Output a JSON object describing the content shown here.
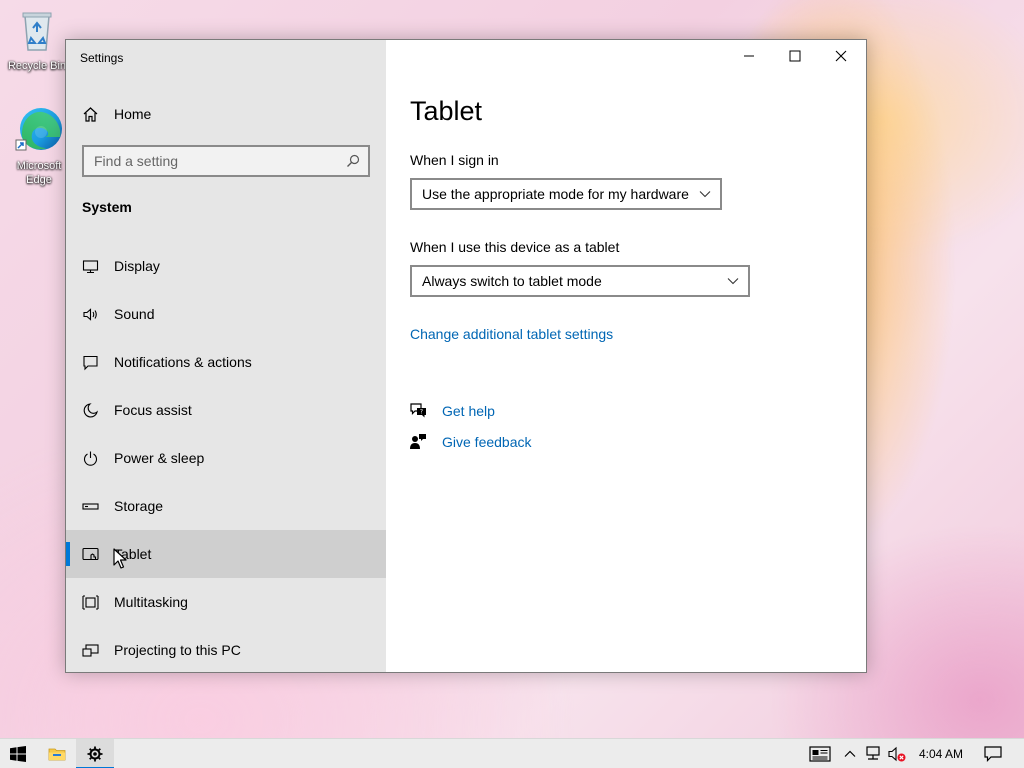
{
  "desktop": {
    "icons": [
      {
        "label": "Recycle Bin",
        "icon": "recycle-bin-icon"
      },
      {
        "label": "Microsoft Edge",
        "icon": "edge-icon"
      }
    ]
  },
  "window": {
    "title": "Settings",
    "controls": [
      "minimize",
      "maximize",
      "close"
    ]
  },
  "sidebar": {
    "home_label": "Home",
    "search_placeholder": "Find a setting",
    "section_title": "System",
    "items": [
      {
        "label": "Display",
        "icon": "display-icon"
      },
      {
        "label": "Sound",
        "icon": "sound-icon"
      },
      {
        "label": "Notifications & actions",
        "icon": "notifications-icon"
      },
      {
        "label": "Focus assist",
        "icon": "focus-assist-icon"
      },
      {
        "label": "Power & sleep",
        "icon": "power-icon"
      },
      {
        "label": "Storage",
        "icon": "storage-icon"
      },
      {
        "label": "Tablet",
        "icon": "tablet-icon",
        "selected": true
      },
      {
        "label": "Multitasking",
        "icon": "multitasking-icon"
      },
      {
        "label": "Projecting to this PC",
        "icon": "projecting-icon"
      }
    ]
  },
  "main": {
    "title": "Tablet",
    "signin_label": "When I sign in",
    "signin_value": "Use the appropriate mode for my hardware",
    "tablet_label": "When I use this device as a tablet",
    "tablet_value": "Always switch to tablet mode",
    "additional_link": "Change additional tablet settings",
    "help_link": "Get help",
    "feedback_link": "Give feedback"
  },
  "taskbar": {
    "clock": "4:04 AM",
    "pinned": [
      "start",
      "file-explorer",
      "settings"
    ]
  },
  "colors": {
    "accent": "#0078d7",
    "link": "#0066b4",
    "sidebar_bg": "#e6e6e6",
    "selected_bg": "#cfcfcf"
  }
}
